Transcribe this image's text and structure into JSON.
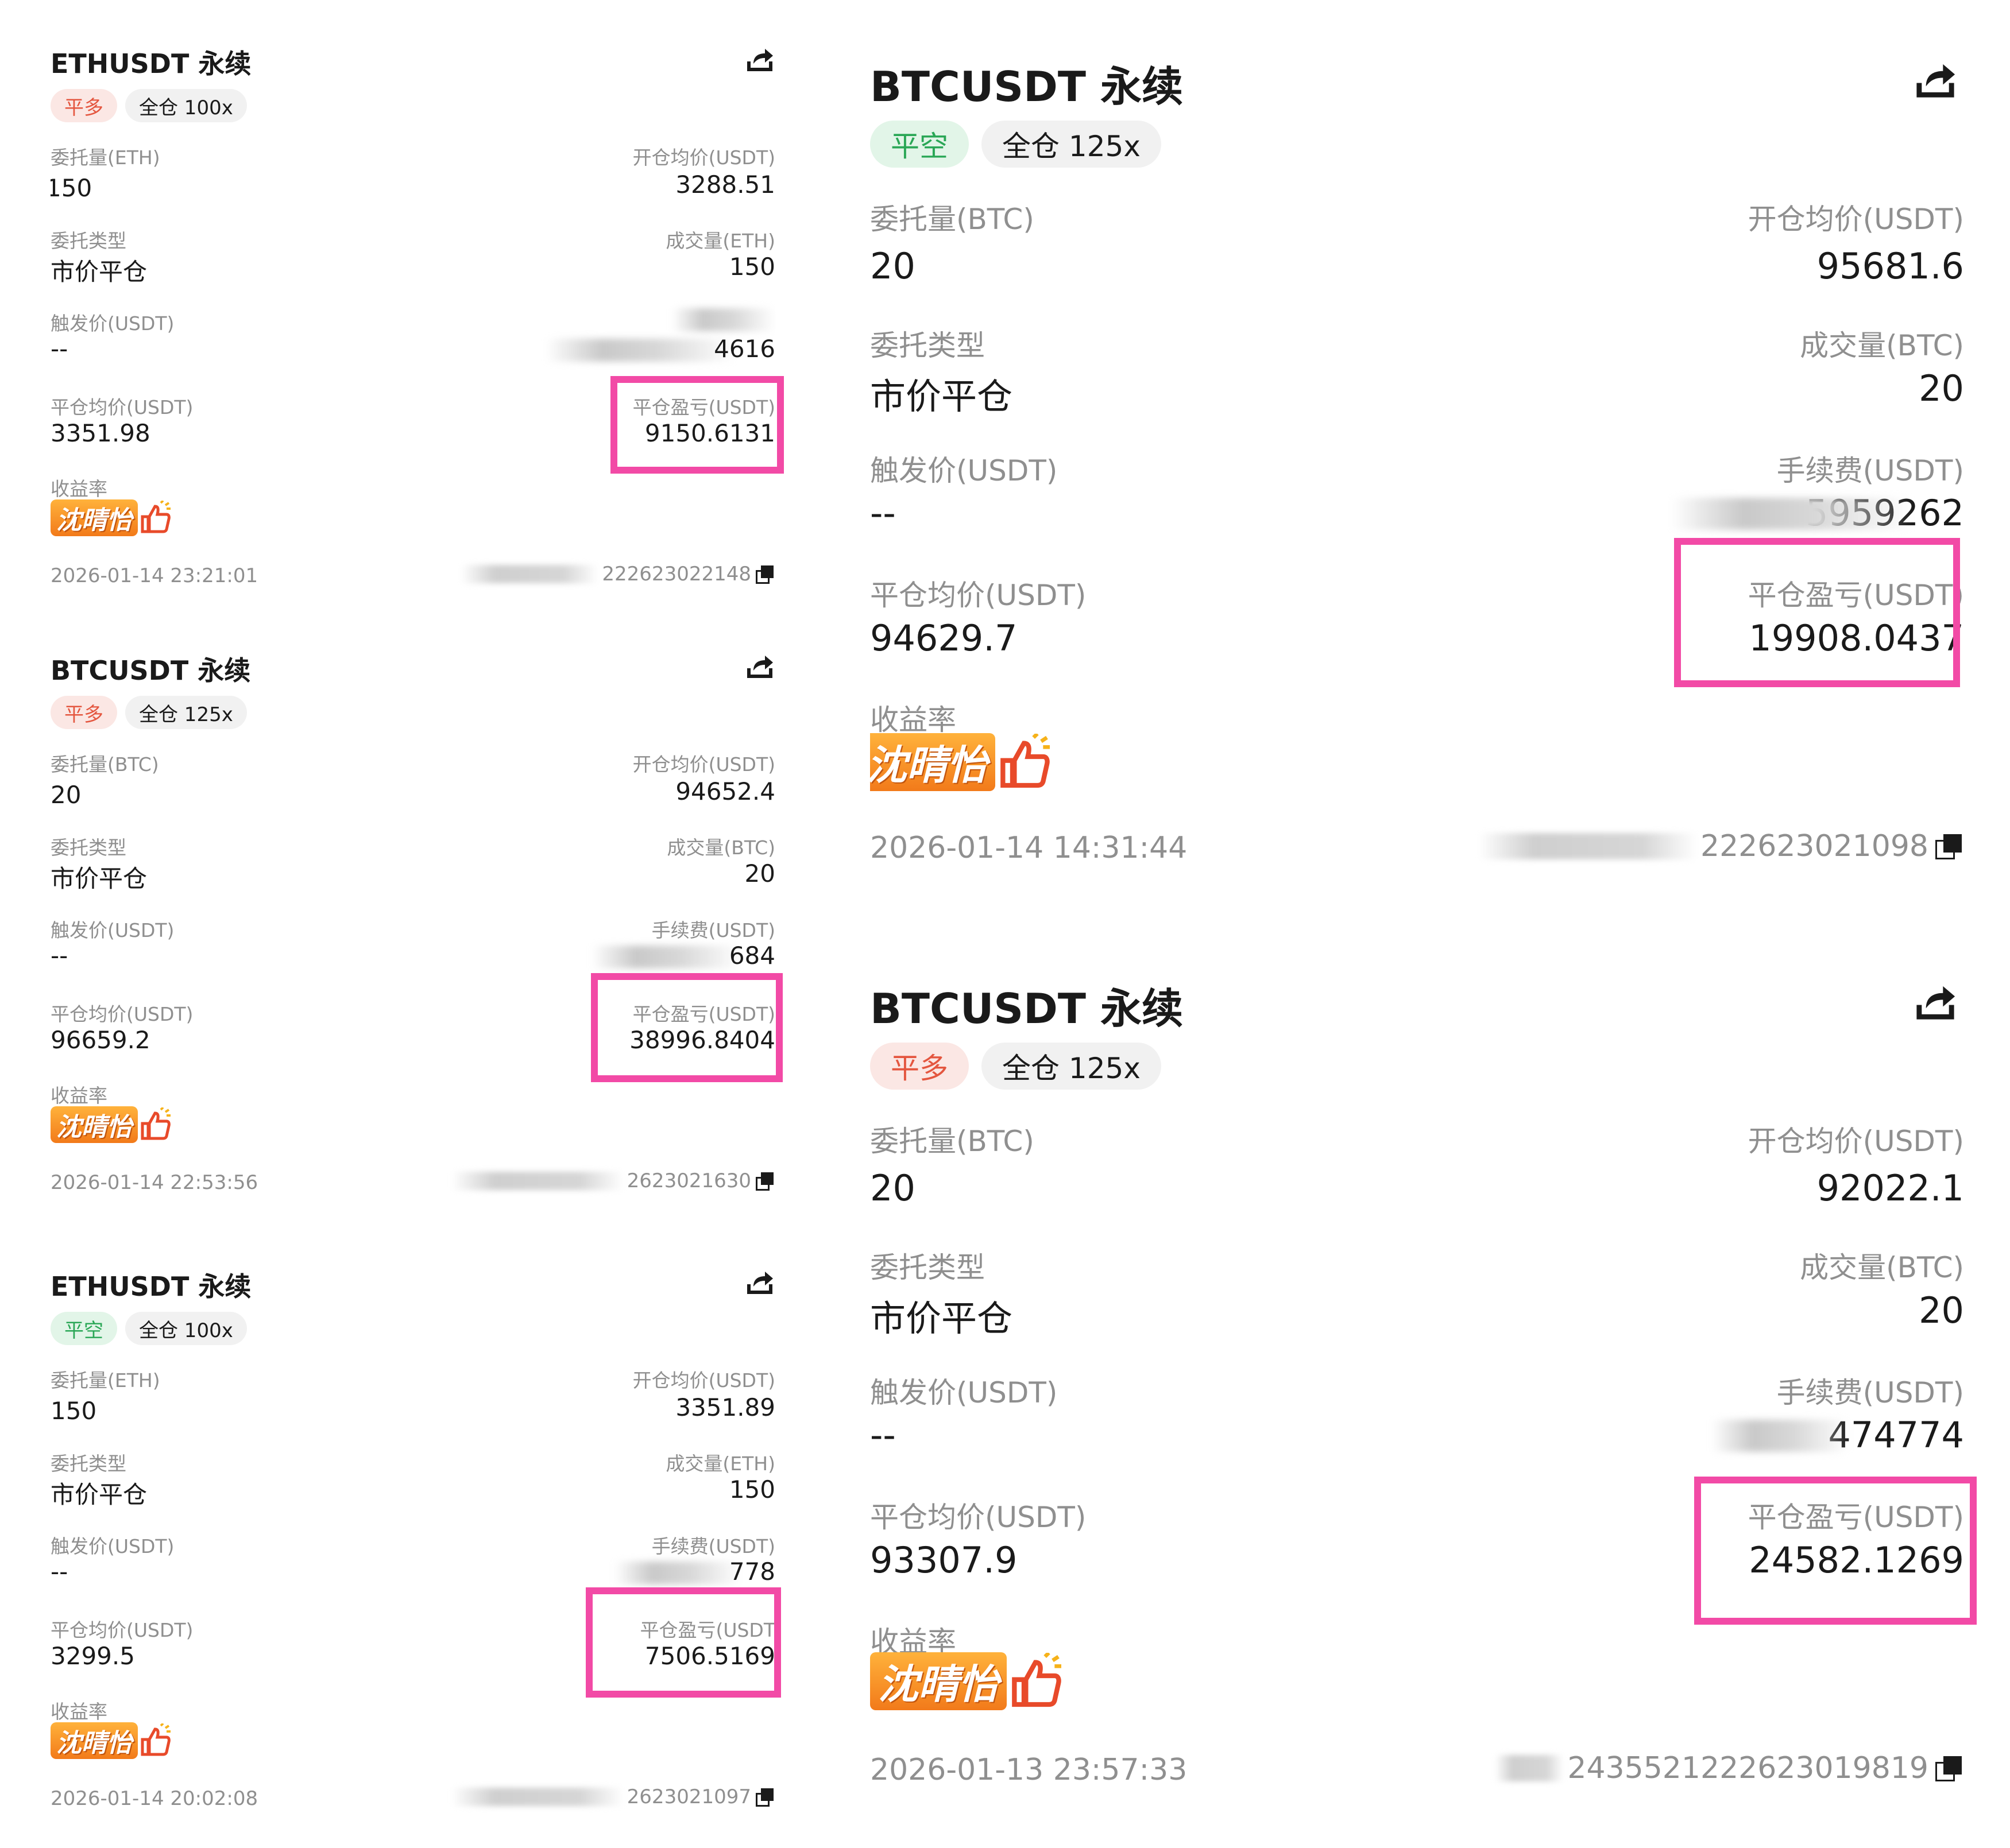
{
  "accent": "#f24aa6",
  "long_color": "#e4563f",
  "short_color": "#2aa756",
  "cards": [
    {
      "symbol": "ETHUSDT 永续",
      "side": "平多",
      "mode": "全仓 100x",
      "qty_label": "委托量(ETH)",
      "qty": "150",
      "open_label": "开仓均价(USDT)",
      "open_price": "3288.51",
      "type_label": "委托类型",
      "type": "市价平仓",
      "filled_label": "成交量(ETH)",
      "filled": "150",
      "trigger_label": "触发价(USDT)",
      "trigger": "--",
      "fee_partial": "4616",
      "close_label": "平仓均价(USDT)",
      "close_price": "3351.98",
      "pnl_label": "平仓盈亏(USDT)",
      "pnl": "9150.6131",
      "yield_label": "收益率",
      "yield_sticker": "沈晴怡",
      "timestamp": "2026-01-14 23:21:01",
      "order_id_partial": "222623022148"
    },
    {
      "symbol": "BTCUSDT 永续",
      "side": "平多",
      "mode": "全仓 125x",
      "qty_label": "委托量(BTC)",
      "qty": "20",
      "open_label": "开仓均价(USDT)",
      "open_price": "94652.4",
      "type_label": "委托类型",
      "type": "市价平仓",
      "filled_label": "成交量(BTC)",
      "filled": "20",
      "trigger_label": "触发价(USDT)",
      "trigger": "--",
      "fee_label": "手续费(USDT)",
      "fee_partial": "684",
      "close_label": "平仓均价(USDT)",
      "close_price": "96659.2",
      "pnl_label": "平仓盈亏(USDT)",
      "pnl": "38996.8404",
      "yield_label": "收益率",
      "yield_sticker": "沈晴怡",
      "timestamp": "2026-01-14 22:53:56",
      "order_id_partial": "2623021630"
    },
    {
      "symbol": "ETHUSDT 永续",
      "side": "平空",
      "mode": "全仓 100x",
      "qty_label": "委托量(ETH)",
      "qty": "150",
      "open_label": "开仓均价(USDT)",
      "open_price": "3351.89",
      "type_label": "委托类型",
      "type": "市价平仓",
      "filled_label": "成交量(ETH)",
      "filled": "150",
      "trigger_label": "触发价(USDT)",
      "trigger": "--",
      "fee_label": "手续费(USDT)",
      "fee_partial": "778",
      "close_label": "平仓均价(USDT)",
      "close_price": "3299.5",
      "pnl_label": "平仓盈亏(USDT",
      "pnl": "7506.5169",
      "yield_label": "收益率",
      "yield_sticker": "沈晴怡",
      "timestamp": "2026-01-14 20:02:08",
      "order_id_partial": "2623021097"
    },
    {
      "symbol": "BTCUSDT 永续",
      "side": "平空",
      "mode": "全仓 125x",
      "qty_label": "委托量(BTC)",
      "qty": "20",
      "open_label": "开仓均价(USDT)",
      "open_price": "95681.6",
      "type_label": "委托类型",
      "type": "市价平仓",
      "filled_label": "成交量(BTC)",
      "filled": "20",
      "trigger_label": "触发价(USDT)",
      "trigger": "--",
      "fee_label": "手续费(USDT)",
      "fee_partial": "5959262",
      "close_label": "平仓均价(USDT)",
      "close_price": "94629.7",
      "pnl_label": "平仓盈亏(USDT)",
      "pnl": "19908.0437",
      "yield_label": "收益率",
      "yield_sticker": "沈晴怡",
      "timestamp": "2026-01-14 14:31:44",
      "order_id_partial": "222623021098"
    },
    {
      "symbol": "BTCUSDT 永续",
      "side": "平多",
      "mode": "全仓 125x",
      "qty_label": "委托量(BTC)",
      "qty": "20",
      "open_label": "开仓均价(USDT)",
      "open_price": "92022.1",
      "type_label": "委托类型",
      "type": "市价平仓",
      "filled_label": "成交量(BTC)",
      "filled": "20",
      "trigger_label": "触发价(USDT)",
      "trigger": "--",
      "fee_label": "手续费(USDT)",
      "fee_partial": "474774",
      "close_label": "平仓均价(USDT)",
      "close_price": "93307.9",
      "pnl_label": "平仓盈亏(USDT)",
      "pnl": "24582.1269",
      "yield_label": "收益率",
      "yield_sticker": "沈晴怡",
      "timestamp": "2026-01-13 23:57:33",
      "order_id_partial": "2435521222623019819"
    }
  ]
}
